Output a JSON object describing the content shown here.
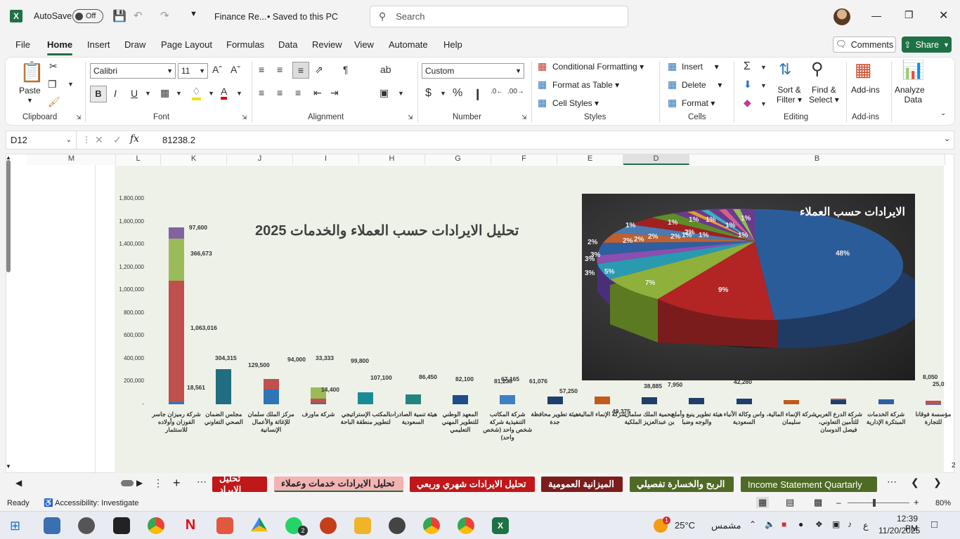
{
  "titlebar": {
    "autosave": "AutoSave",
    "autosave_state": "Off",
    "filename": "Finance Re...",
    "saved": "Saved to this PC",
    "search_placeholder": "Search"
  },
  "menu": {
    "tabs": [
      "File",
      "Home",
      "Insert",
      "Draw",
      "Page Layout",
      "Formulas",
      "Data",
      "Review",
      "View",
      "Automate",
      "Help"
    ],
    "comments": "Comments",
    "share": "Share"
  },
  "ribbon": {
    "clipboard": {
      "label": "Clipboard",
      "paste": "Paste"
    },
    "font": {
      "label": "Font",
      "name": "Calibri",
      "size": "11"
    },
    "alignment": {
      "label": "Alignment"
    },
    "number": {
      "label": "Number",
      "format": "Custom"
    },
    "styles": {
      "label": "Styles",
      "conditional": "Conditional Formatting",
      "table": "Format as Table",
      "cell": "Cell Styles"
    },
    "cells": {
      "label": "Cells",
      "insert": "Insert",
      "delete": "Delete",
      "format": "Format"
    },
    "editing": {
      "label": "Editing",
      "sort": "Sort &",
      "sort2": "Filter",
      "find": "Find &",
      "find2": "Select"
    },
    "addins": {
      "label": "Add-ins",
      "addins": "Add-ins",
      "analyze": "Analyze",
      "analyze2": "Data"
    }
  },
  "formula": {
    "namebox": "D12",
    "value": "81238.2"
  },
  "columns": [
    "M",
    "L",
    "K",
    "J",
    "I",
    "H",
    "G",
    "F",
    "E",
    "D",
    "B"
  ],
  "chart_data": [
    {
      "type": "bar",
      "title": "تحليل الايرادات حسب العملاء والخدمات 2025",
      "ylim": [
        0,
        1800000
      ],
      "yticks": [
        "1,800,000",
        "1,600,000",
        "1,400,000",
        "1,200,000",
        "1,000,000",
        "800,000",
        "600,000",
        "400,000",
        "200,000",
        "-"
      ],
      "categories": [
        "شركة رميزان جاسر الفوزان وأولاده للاستثمار",
        "مجلس الضمان الصحي التعاوني",
        "مركز الملك سلمان للإغاثة والأعمال الإنسانية",
        "شركة ماورف",
        "المكتب الإستراتيجي لتطوير منطقة الباحة",
        "هيئة تنمية الصادرات السعودية",
        "المعهد الوطني للتطوير المهني التعليمي",
        "شركة المكاتب التنفيذية شركة شخص واحد (شخص واحد)",
        "هيئة تطوير محافظة جدة",
        "شركة الإنماء المالية",
        "محمية الملك سلمان بن عبدالعزيز الملكية",
        "هيئة تطوير ينبع وأملج والوجه وضبا",
        "واس وكالة الأنباء السعودية",
        "شركة الإنماء المالية، سليمان",
        "شركة الدرع العربي للتأمين التعاوني، فيصل الدوسان",
        "شركة الخدمات المبتكرة الإدارية",
        "مؤسسة فوقانا للتجارة"
      ],
      "labels": [
        "18,561",
        "1,063,016",
        "366,673",
        "97,600",
        "304,315",
        "129,500",
        "94,000",
        "14,400",
        "33,333",
        "99,800",
        "107,100",
        "86,450",
        "82,100",
        "81,238",
        "67,165",
        "61,076",
        "57,250",
        "49,375",
        "38,885",
        "7,950",
        "42,280",
        "8,050",
        "25,0"
      ],
      "series": [
        {
          "values": [
            18561,
            304315,
            129500,
            14400,
            107100,
            86450,
            82100,
            81238,
            67165,
            70000,
            61076,
            57250,
            49375,
            38885,
            38885,
            42280,
            8050
          ]
        },
        {
          "values": [
            1063016,
            0,
            94000,
            33333,
            0,
            0,
            0,
            0,
            0,
            0,
            0,
            0,
            0,
            0,
            7950,
            0,
            25000
          ]
        },
        {
          "values": [
            366673,
            0,
            0,
            99800,
            0,
            0,
            0,
            0,
            0,
            0,
            0,
            0,
            0,
            0,
            0,
            0,
            0
          ]
        },
        {
          "values": [
            97600,
            0,
            0,
            0,
            0,
            0,
            0,
            0,
            0,
            0,
            0,
            0,
            0,
            0,
            0,
            0,
            0
          ]
        }
      ]
    },
    {
      "type": "pie",
      "title": "الايرادات حسب العملاء",
      "labels": [
        "48%",
        "9%",
        "7%",
        "5%",
        "3%",
        "3%",
        "3%",
        "2%",
        "2%",
        "2%",
        "2%",
        "2%",
        "2%",
        "1%",
        "1%",
        "1%",
        "1%",
        "1%",
        "1%",
        "1%",
        "1%",
        "1%"
      ]
    }
  ],
  "sheets": [
    "تحليل الايراد",
    "تحليل الايرادات خدمات وعملاء",
    "تحليل الايرادات شهري وربعي",
    "الميزانية العمومية",
    "الربح والخسارة تفصيلي",
    "Income Statement Quartarly"
  ],
  "status": {
    "ready": "Ready",
    "accessibility": "Accessibility: Investigate",
    "zoom": "80%"
  },
  "taskbar": {
    "temp": "25°C",
    "weather": "مشمس",
    "time": "12:39 PM",
    "date": "11/20/2025",
    "lang": "ع",
    "badge": "1",
    "badge2": "2"
  },
  "colors": {
    "excel": "#1e7145",
    "bar1": "#2e75b6",
    "bar2": "#c0504d",
    "bar3": "#9bbb59",
    "bar4": "#8064a2",
    "teal": "#216e81"
  }
}
